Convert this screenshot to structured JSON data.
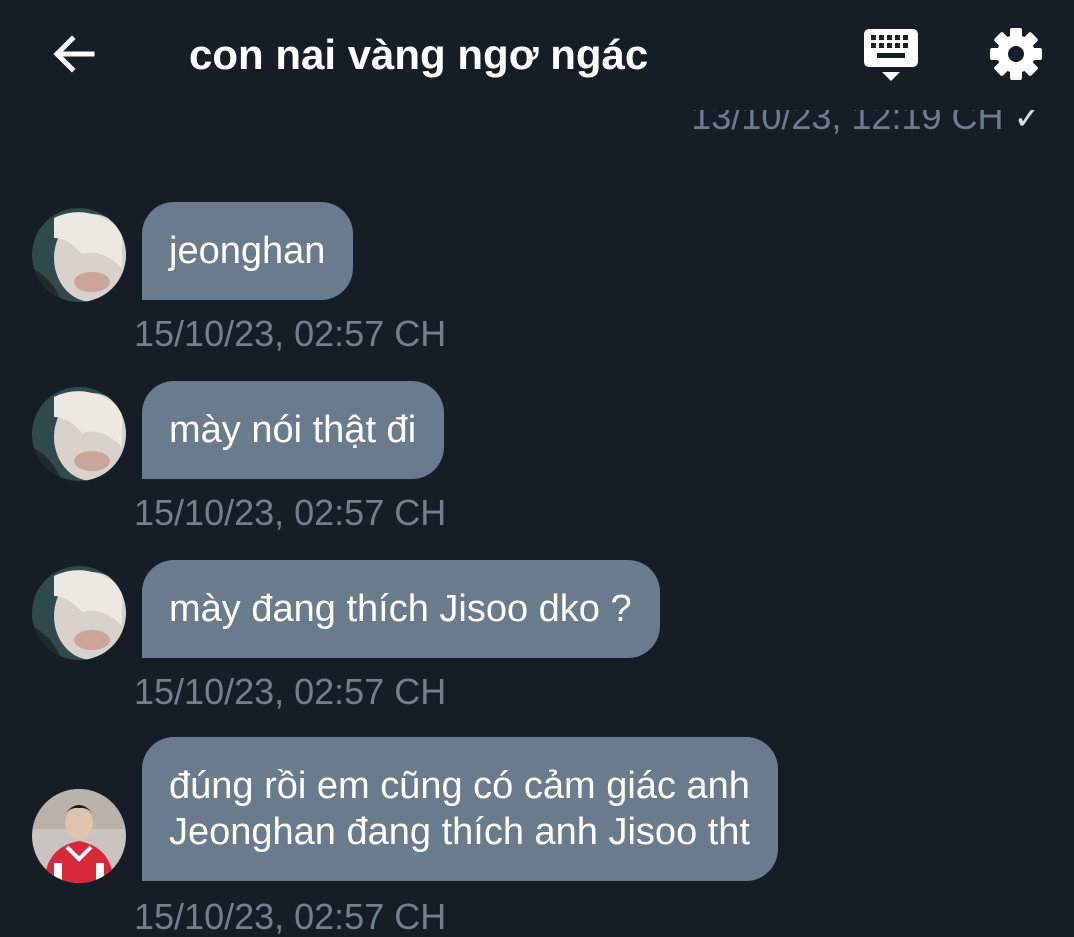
{
  "header": {
    "title": "con nai vàng ngơ ngác",
    "back_icon": "arrow-left-icon",
    "keyboard_icon": "keyboard-icon",
    "settings_icon": "gear-icon"
  },
  "previous_message": {
    "timestamp": "13/10/23, 12:19 CH",
    "status_icon": "check-icon"
  },
  "messages": [
    {
      "sender": "jeonghan-avatar",
      "text": "jeonghan",
      "timestamp": "15/10/23, 02:57 CH"
    },
    {
      "sender": "jeonghan-avatar",
      "text": "mày nói thật đi",
      "timestamp": "15/10/23, 02:57 CH"
    },
    {
      "sender": "jeonghan-avatar",
      "text": "mày đang thích Jisoo dko ?",
      "timestamp": "15/10/23, 02:57 CH"
    },
    {
      "sender": "second-avatar",
      "text_line1": "đúng rồi em cũng có cảm giác anh",
      "text_line2": "Jeonghan đang thích anh Jisoo tht",
      "timestamp": "15/10/23, 02:57 CH"
    }
  ],
  "colors": {
    "background": "#151d27",
    "bubble": "#6a7b8d",
    "timestamp": "#71808f"
  }
}
